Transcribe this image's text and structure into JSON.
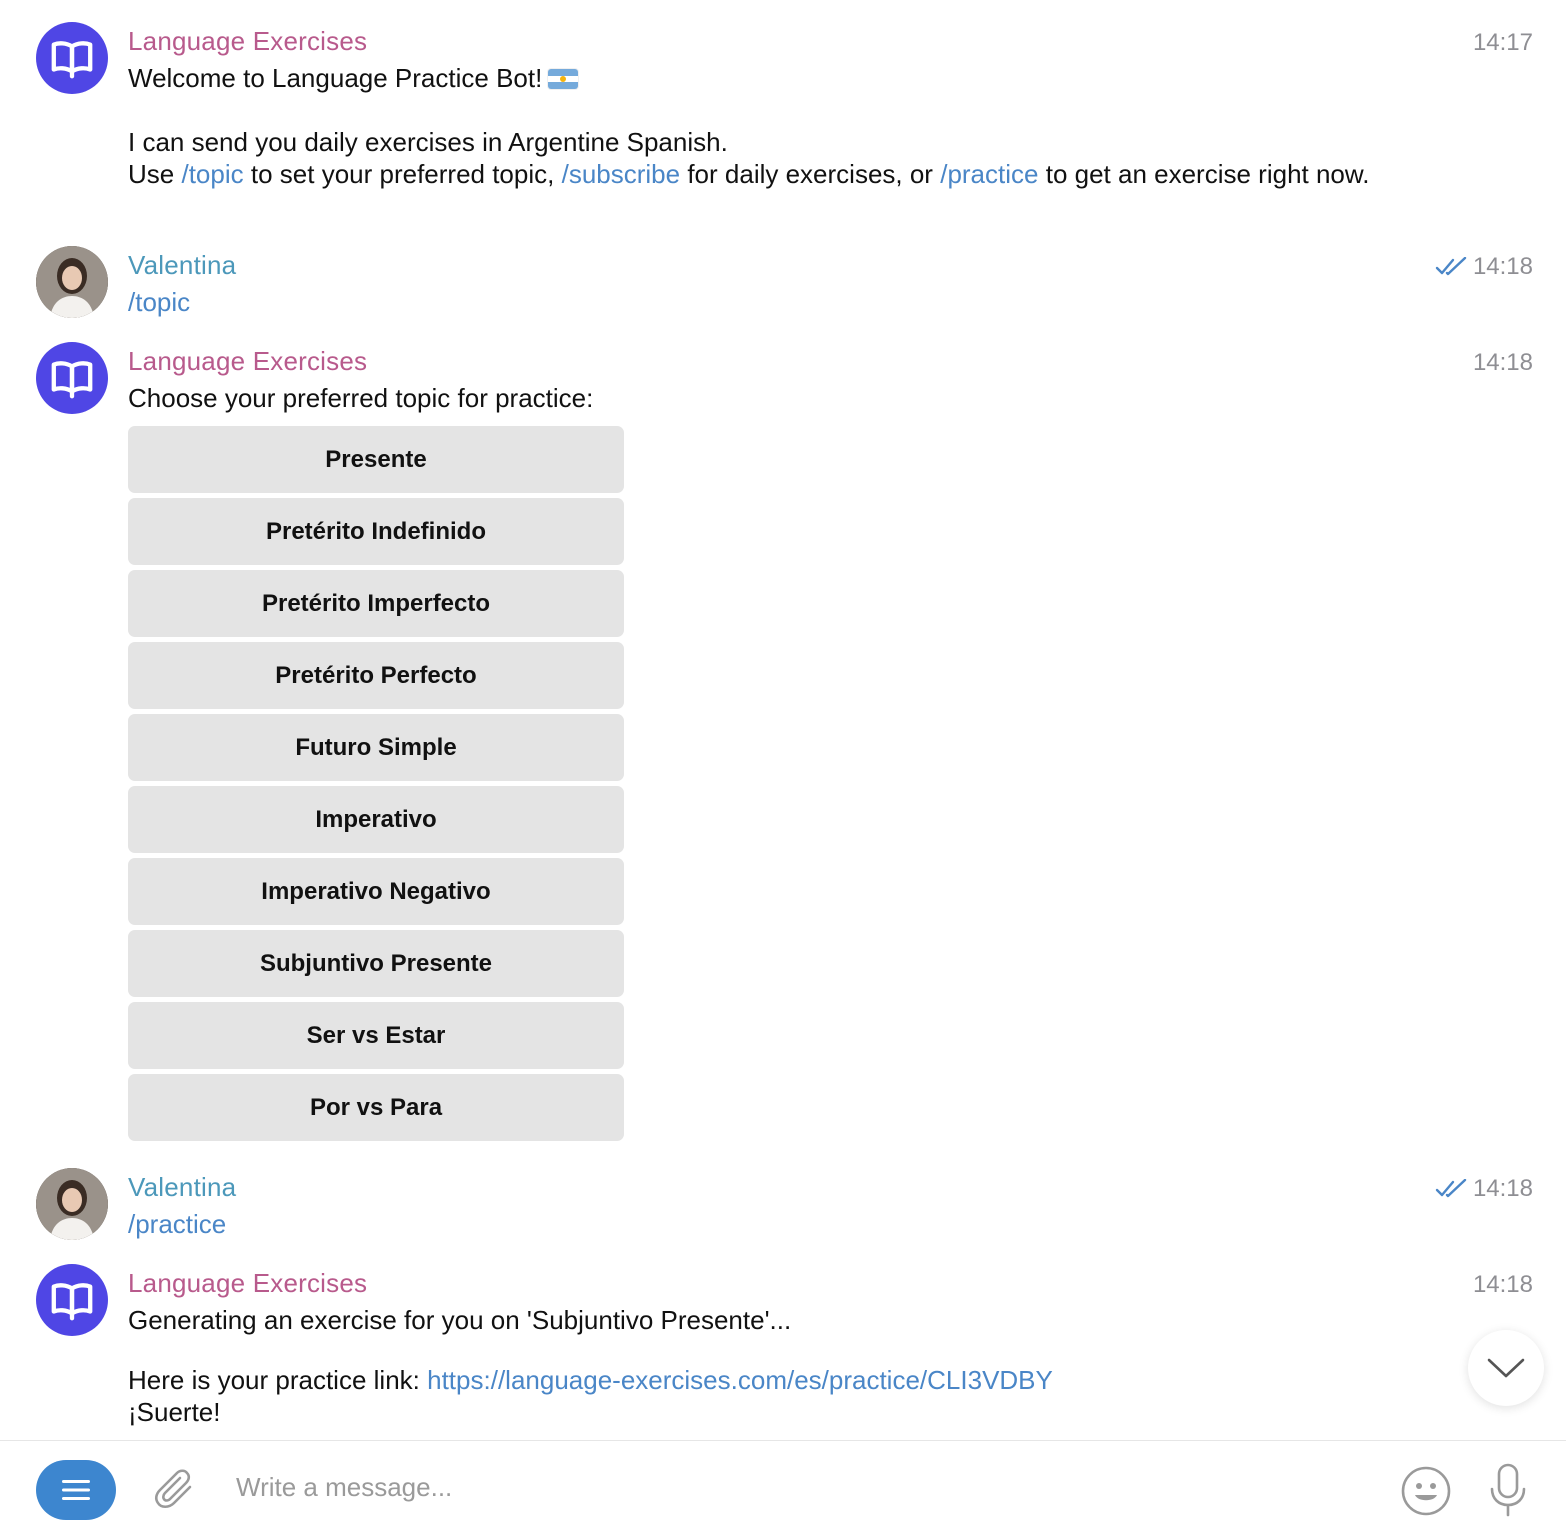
{
  "messages": {
    "m1": {
      "sender": "Language Exercises",
      "time": "14:17",
      "line1": "Welcome to Language Practice Bot!",
      "line2": "I can send you daily exercises in Argentine Spanish.",
      "use": "Use",
      "cmd_topic": "/topic",
      "text_a": "to set your preferred topic,",
      "cmd_subscribe": "/subscribe",
      "text_b": "for daily exercises, or",
      "cmd_practice": "/practice",
      "text_c": "to get an exercise right now."
    },
    "m2": {
      "sender": "Valentina",
      "time": "14:18",
      "text": "/topic"
    },
    "m3": {
      "sender": "Language Exercises",
      "time": "14:18",
      "text": "Choose your preferred topic for practice:",
      "buttons": [
        "Presente",
        "Pretérito Indefinido",
        "Pretérito Imperfecto",
        "Pretérito Perfecto",
        "Futuro Simple",
        "Imperativo",
        "Imperativo Negativo",
        "Subjuntivo Presente",
        "Ser vs Estar",
        "Por vs Para"
      ]
    },
    "m4": {
      "sender": "Valentina",
      "time": "14:18",
      "text": "/practice"
    },
    "m5": {
      "sender": "Language Exercises",
      "time": "14:18",
      "line1": "Generating an exercise for you on 'Subjuntivo Presente'...",
      "link_prefix": "Here is your practice link:",
      "link": "https://language-exercises.com/es/practice/CLI3VDBY",
      "line3": "¡Suerte!"
    }
  },
  "composer": {
    "placeholder": "Write a message..."
  },
  "icons": {
    "bot_avatar": "book-icon",
    "read_status": "double-check-icon",
    "scroll": "chevron-down-icon",
    "menu": "menu-icon",
    "attach": "paperclip-icon",
    "emoji": "smiley-icon",
    "mic": "microphone-icon"
  },
  "colors": {
    "bot_name": "#b85a8c",
    "user_name": "#4c98ba",
    "link": "#4a86c7",
    "bot_avatar_bg": "#4f46e5",
    "menu_button": "#3d86cf",
    "keyboard_button": "#e4e4e4"
  }
}
